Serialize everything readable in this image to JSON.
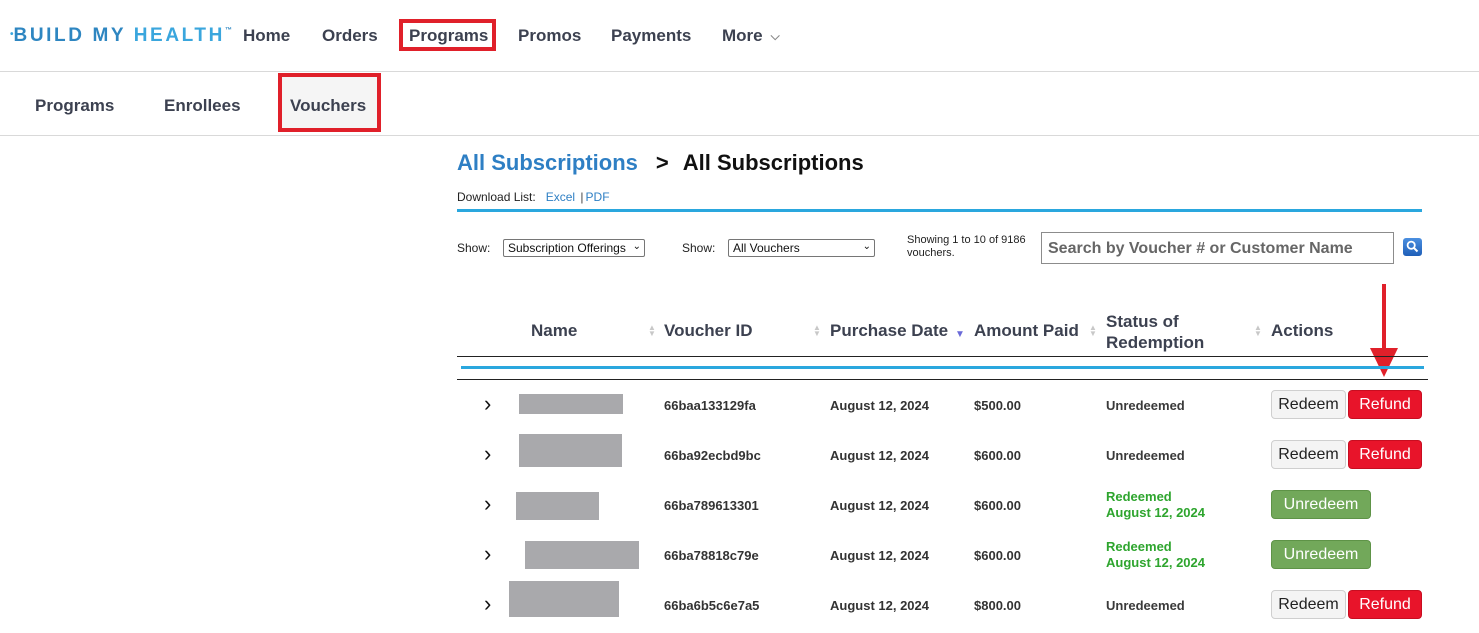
{
  "brand": {
    "build": "BUILD",
    "my": "MY",
    "health": "HEALTH",
    "tm": "™"
  },
  "nav": {
    "home": "Home",
    "orders": "Orders",
    "programs": "Programs",
    "promos": "Promos",
    "payments": "Payments",
    "more": "More"
  },
  "subnav": {
    "programs": "Programs",
    "enrollees": "Enrollees",
    "vouchers": "Vouchers"
  },
  "breadcrumb": {
    "parent": "All Subscriptions",
    "separator": ">",
    "current": "All Subscriptions"
  },
  "download": {
    "label": "Download List:",
    "excel": "Excel",
    "pdf": "PDF"
  },
  "filters": {
    "show_label": "Show:",
    "offering_selected": "Subscription Offerings",
    "voucher_selected": "All Vouchers",
    "showing_line1": "Showing 1 to 10 of 9186",
    "showing_line2": "vouchers.",
    "search_placeholder": "Search by Voucher # or Customer Name"
  },
  "table": {
    "headers": {
      "name": "Name",
      "voucher_id": "Voucher ID",
      "purchase_date": "Purchase Date",
      "amount_paid": "Amount Paid",
      "status_line1": "Status of",
      "status_line2": "Redemption",
      "actions": "Actions"
    },
    "rows": [
      {
        "voucher_id": "66baa133129fa",
        "purchase_date": "August 12, 2024",
        "amount": "$500.00",
        "status": "Unredeemed",
        "status_date": ""
      },
      {
        "voucher_id": "66ba92ecbd9bc",
        "purchase_date": "August 12, 2024",
        "amount": "$600.00",
        "status": "Unredeemed",
        "status_date": ""
      },
      {
        "voucher_id": "66ba789613301",
        "purchase_date": "August 12, 2024",
        "amount": "$600.00",
        "status": "Redeemed",
        "status_date": "August 12, 2024"
      },
      {
        "voucher_id": "66ba78818c79e",
        "purchase_date": "August 12, 2024",
        "amount": "$600.00",
        "status": "Redeemed",
        "status_date": "August 12, 2024"
      },
      {
        "voucher_id": "66ba6b5c6e7a5",
        "purchase_date": "August 12, 2024",
        "amount": "$800.00",
        "status": "Unredeemed",
        "status_date": ""
      }
    ],
    "actions": {
      "redeem": "Redeem",
      "refund": "Refund",
      "unredeem": "Unredeem"
    }
  },
  "colors": {
    "brand_blue": "#2e86c1",
    "accent_blue": "#2aa7de",
    "highlight_red": "#e0202a",
    "refund_red": "#e8142a",
    "unredeem_green": "#72a85a",
    "redeemed_text_green": "#2ea52e"
  },
  "icons": {
    "search": "search-icon",
    "expand": "chevron-right-icon",
    "more": "chevron-down-icon",
    "annotation": "red-arrow-icon"
  }
}
